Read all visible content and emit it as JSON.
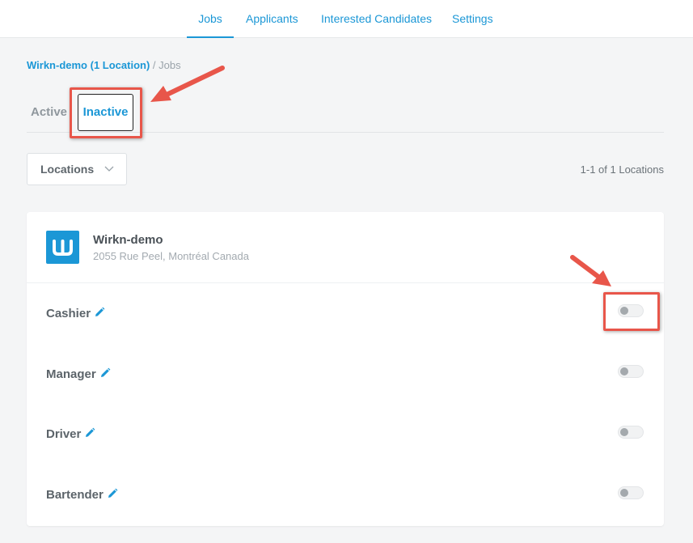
{
  "topnav": {
    "tabs": [
      {
        "label": "Jobs",
        "active": true
      },
      {
        "label": "Applicants",
        "active": false
      },
      {
        "label": "Interested Candidates",
        "active": false
      },
      {
        "label": "Settings",
        "active": false
      }
    ]
  },
  "breadcrumb": {
    "link": "Wirkn-demo (1 Location)",
    "separator": " / ",
    "current": "Jobs"
  },
  "status_tabs": {
    "active_label": "Active",
    "inactive_label": "Inactive",
    "selected": "Inactive"
  },
  "filters": {
    "locations_label": "Locations",
    "results_count": "1-1 of 1 Locations"
  },
  "location_card": {
    "logo_letter": "w",
    "name": "Wirkn-demo",
    "address": "2055 Rue Peel, Montréal Canada",
    "jobs": [
      {
        "title": "Cashier",
        "enabled": false
      },
      {
        "title": "Manager",
        "enabled": false
      },
      {
        "title": "Driver",
        "enabled": false
      },
      {
        "title": "Bartender",
        "enabled": false
      }
    ]
  },
  "colors": {
    "accent": "#1b97d6",
    "annotation": "#e8564a",
    "background": "#f4f5f6"
  },
  "icons": {
    "edit": "pencil-icon",
    "dropdown": "chevron-down-icon"
  }
}
